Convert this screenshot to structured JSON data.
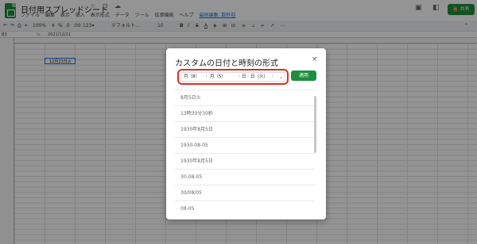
{
  "header": {
    "doc_title": "日付用スプレッドシート",
    "title_icons": "☆ ⊡ ☁",
    "menu": [
      "ファイル",
      "編集",
      "表示",
      "挿入",
      "表示形式",
      "データ",
      "ツール",
      "拡張機能",
      "ヘルプ"
    ],
    "last_edit": "最終編集: 数秒前",
    "share_label": "🔒 共有"
  },
  "toolbar": {
    "zoom": "100%",
    "currency": "¥",
    "percent": "%",
    "dec1": ".0",
    "dec2": ".00",
    "numfmt": "123▾",
    "font": "デフォルト...",
    "font_size": "10"
  },
  "formula_bar": {
    "name_box": "B3",
    "fx": "fx",
    "value": "2021/12/21"
  },
  "sheet": {
    "cell_text": "12月21日火"
  },
  "dialog": {
    "title": "カスタムの日付と時刻の形式",
    "close": "×",
    "format_tokens": [
      "月（8）",
      "月（5）",
      "日（火）"
    ],
    "format_prefix": "日",
    "apply_label": "適用",
    "options": [
      "8月5日火",
      "13時30分30秒",
      "1930年8月5日",
      "1930-08-05",
      "1930年8月5日",
      "30-08-05",
      "30/08/05",
      "08-05"
    ]
  },
  "colors": {
    "accent_green": "#1e8e3e",
    "highlight_red": "#d93025",
    "selection_blue": "#1a73e8"
  }
}
